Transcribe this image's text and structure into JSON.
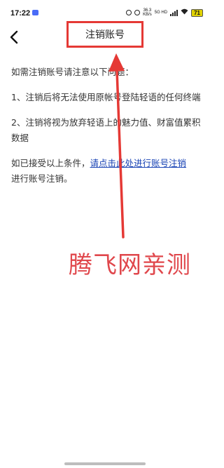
{
  "status_bar": {
    "time": "17:22",
    "net_speed": "36.3",
    "net_unit": "KB/s",
    "network": "5G HD",
    "battery": "71"
  },
  "header": {
    "title": "注销账号"
  },
  "content": {
    "intro": "如需注销账号请注意以下问题：",
    "items": [
      "1、注销后将无法使用原帐号登陆轻语的任何终端",
      "2、注销将视为放弃轻语上的魅力值、财富值累积数据"
    ],
    "confirm_prefix": "如已接受以上条件，",
    "confirm_link": "请点击此处进行账号注销",
    "confirm_suffix": "进行账号注销。"
  },
  "watermark": "腾飞网亲测",
  "colors": {
    "annotation_red": "#e53935",
    "link_blue": "#1a44b5",
    "battery_yellow": "#e0d200"
  }
}
